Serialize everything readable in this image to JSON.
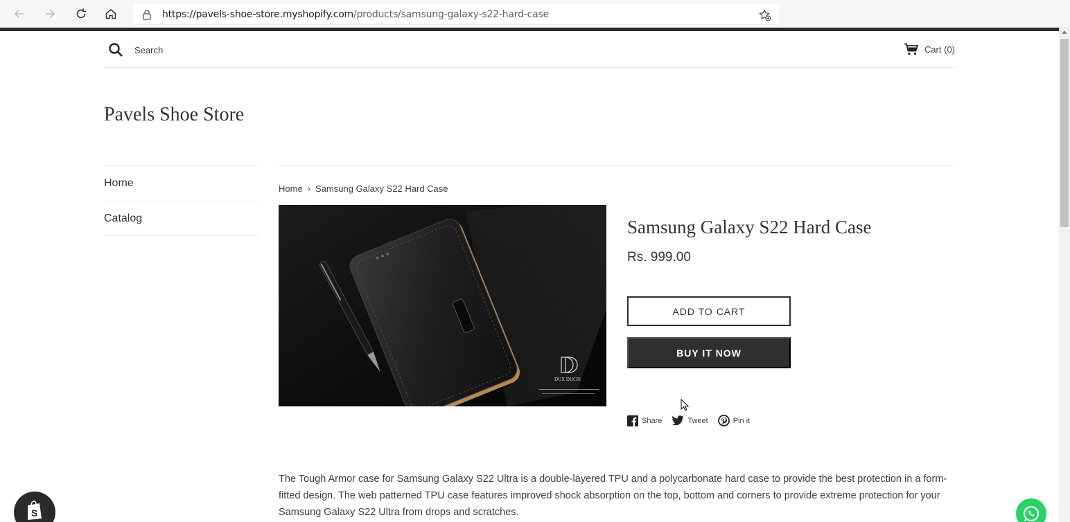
{
  "browser": {
    "url_host": "https://pavels-shoe-store.myshopify.com",
    "url_path": "/products/samsung-galaxy-s22-hard-case"
  },
  "header": {
    "search_label": "Search",
    "cart_label": "Cart (0)"
  },
  "store": {
    "title": "Pavels Shoe Store"
  },
  "sidebar": {
    "items": [
      {
        "label": "Home"
      },
      {
        "label": "Catalog"
      }
    ]
  },
  "breadcrumb": {
    "home": "Home",
    "separator": "›",
    "current": "Samsung Galaxy S22 Hard Case"
  },
  "product": {
    "title": "Samsung Galaxy S22 Hard Case",
    "price": "Rs. 999.00",
    "add_to_cart": "ADD TO CART",
    "buy_now": "BUY IT NOW",
    "image_brand": "DUX DUCIS",
    "description": "The Tough Armor case for Samsung Galaxy S22 Ultra is a double-layered TPU and a polycarbonate hard case to provide the best protection in a form-fitted design. The web patterned TPU case features improved shock absorption on the top, bottom and corners to provide extreme protection for your Samsung Galaxy S22 Ultra from drops and scratches."
  },
  "share": {
    "facebook": "Share",
    "twitter": "Tweet",
    "pinterest": "Pin it"
  },
  "colors": {
    "primary_button": "#2f2f2f",
    "whatsapp": "#25d366"
  }
}
